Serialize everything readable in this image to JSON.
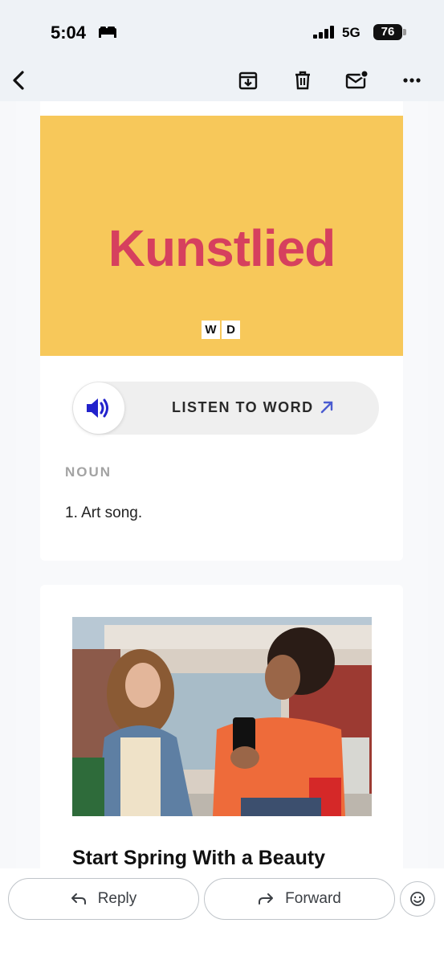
{
  "status_bar": {
    "time": "5:04",
    "network": "5G",
    "battery": "76"
  },
  "toolbar": {
    "icons": [
      "back-icon",
      "archive-icon",
      "trash-icon",
      "mark-unread-icon",
      "more-icon"
    ]
  },
  "word_card": {
    "word": "Kunstlied",
    "logo": [
      "W",
      "D"
    ],
    "listen_label": "LISTEN TO WORD",
    "part_of_speech": "NOUN",
    "definition": "1. Art song."
  },
  "promo_card": {
    "headline": "Start Spring With a Beauty"
  },
  "actions": {
    "reply_label": "Reply",
    "forward_label": "Forward"
  },
  "colors": {
    "banner": "#f7c85a",
    "word": "#d6405e",
    "speaker_icon": "#2222cc",
    "arrow": "#4a5bd0"
  }
}
